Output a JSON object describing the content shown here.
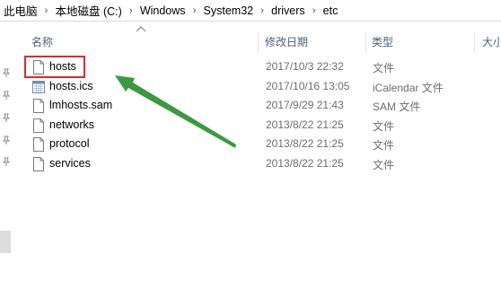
{
  "breadcrumb": [
    "此电脑",
    "本地磁盘 (C:)",
    "Windows",
    "System32",
    "drivers",
    "etc"
  ],
  "columns": {
    "name": "名称",
    "modified": "修改日期",
    "type": "类型",
    "size": "大小"
  },
  "files": [
    {
      "name": "hosts",
      "modified": "2017/10/3 22:32",
      "type": "文件",
      "icon": "file-icon"
    },
    {
      "name": "hosts.ics",
      "modified": "2017/10/16 13:05",
      "type": "iCalendar 文件",
      "icon": "calendar-file-icon"
    },
    {
      "name": "lmhosts.sam",
      "modified": "2017/9/29 21:43",
      "type": "SAM 文件",
      "icon": "file-icon"
    },
    {
      "name": "networks",
      "modified": "2013/8/22 21:25",
      "type": "文件",
      "icon": "file-icon"
    },
    {
      "name": "protocol",
      "modified": "2013/8/22 21:25",
      "type": "文件",
      "icon": "file-icon"
    },
    {
      "name": "services",
      "modified": "2013/8/22 21:25",
      "type": "文件",
      "icon": "file-icon"
    }
  ],
  "colors": {
    "highlight": "#e0282e",
    "annotation_arrow": "#3a9a3f",
    "header_text": "#4c607a"
  }
}
